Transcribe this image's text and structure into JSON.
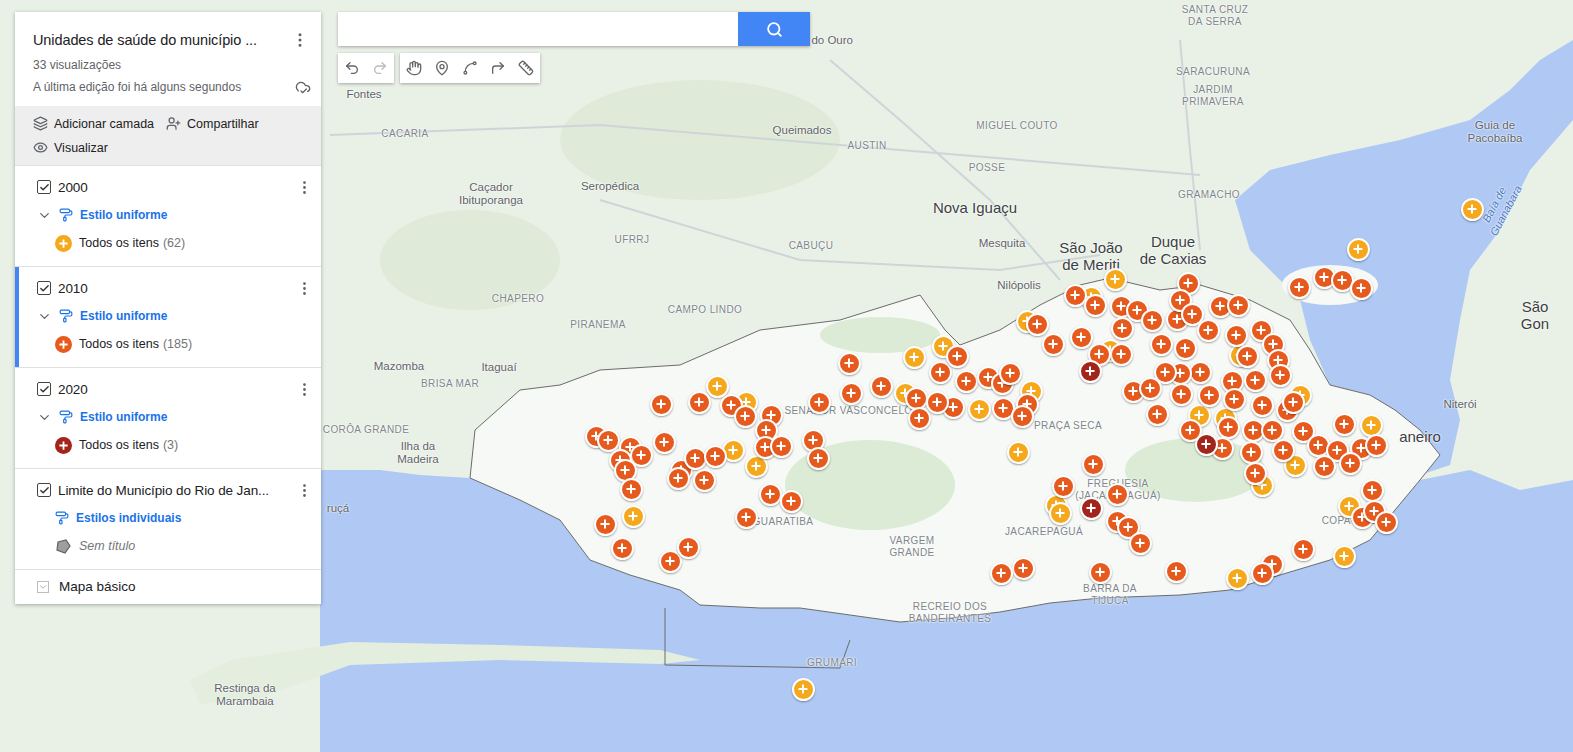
{
  "panel": {
    "title": "Unidades de saúde do município ...",
    "views": "33 visualizações",
    "edited": "A última edição foi há alguns segundos",
    "actions": [
      {
        "label": "Adicionar camada",
        "kind": "layer"
      },
      {
        "label": "Compartilhar",
        "kind": "share"
      },
      {
        "label": "Visualizar",
        "kind": "view"
      }
    ]
  },
  "layers": [
    {
      "name": "2000",
      "checked": true,
      "selected": false,
      "expanded": true,
      "style": "Estilo uniforme",
      "items_label": "Todos os itens",
      "count": "(62)",
      "color": "#f6a81c",
      "kind": "points"
    },
    {
      "name": "2010",
      "checked": true,
      "selected": true,
      "expanded": true,
      "style": "Estilo uniforme",
      "items_label": "Todos os itens",
      "count": "(185)",
      "color": "#e65a1e",
      "kind": "points"
    },
    {
      "name": "2020",
      "checked": true,
      "selected": false,
      "expanded": true,
      "style": "Estilo uniforme",
      "items_label": "Todos os itens",
      "count": "(3)",
      "color": "#a3241a",
      "kind": "points"
    },
    {
      "name": "Limite do Município do Rio de Jan...",
      "checked": true,
      "selected": false,
      "expanded": false,
      "style": "Estilos individuais",
      "items_label": "Sem título",
      "count": "",
      "color": "#5f6368",
      "kind": "boundary"
    }
  ],
  "base_map": {
    "label": "Mapa básico",
    "expanded": false
  },
  "search": {
    "placeholder": ""
  },
  "map": {
    "labels": [
      {
        "text": "Rio do Ouro",
        "kind": "town"
      },
      {
        "text": "SANTA CRUZ\nDA SERRA",
        "kind": "district"
      },
      {
        "text": "SARACURUNA",
        "kind": "district"
      },
      {
        "text": "JARDIM\nPRIMAVERA",
        "kind": "district"
      },
      {
        "text": "Fontes",
        "kind": "town"
      },
      {
        "text": "Queimados",
        "kind": "town"
      },
      {
        "text": "MIGUEL COUTO",
        "kind": "district"
      },
      {
        "text": "AUSTIN",
        "kind": "district"
      },
      {
        "text": "POSSE",
        "kind": "district"
      },
      {
        "text": "CACARIA",
        "kind": "district"
      },
      {
        "text": "GRAMACHO",
        "kind": "district"
      },
      {
        "text": "Guia de\nPacobaíba",
        "kind": "town"
      },
      {
        "text": "Baía de Guanabara",
        "kind": "water"
      },
      {
        "text": "Seropédica",
        "kind": "town"
      },
      {
        "text": "Caçador\nIbituporanga",
        "kind": "town"
      },
      {
        "text": "Nova Iguaçu",
        "kind": "city"
      },
      {
        "text": "São João\nde Meriti",
        "kind": "city"
      },
      {
        "text": "Duque\nde Caxias",
        "kind": "city"
      },
      {
        "text": "UFRRJ",
        "kind": "district"
      },
      {
        "text": "Mesquita",
        "kind": "town"
      },
      {
        "text": "CABUÇU",
        "kind": "district"
      },
      {
        "text": "Nilópolis",
        "kind": "town"
      },
      {
        "text": "CHAPERO",
        "kind": "district"
      },
      {
        "text": "CAMPO LINDO",
        "kind": "district"
      },
      {
        "text": "São Gon",
        "kind": "city"
      },
      {
        "text": "PIRANEMA",
        "kind": "district"
      },
      {
        "text": "Mazomba",
        "kind": "town"
      },
      {
        "text": "Itaguaí",
        "kind": "town"
      },
      {
        "text": "BRISA MAR",
        "kind": "district"
      },
      {
        "text": "Niterói",
        "kind": "town"
      },
      {
        "text": "CORÔA GRANDE",
        "kind": "district"
      },
      {
        "text": "Ilha da\nMadeira",
        "kind": "town"
      },
      {
        "text": "SENADOR VASCONCELOS",
        "kind": "district"
      },
      {
        "text": "PRAÇA SECA",
        "kind": "district"
      },
      {
        "text": "aneiro",
        "kind": "city"
      },
      {
        "text": "GUARATIBA",
        "kind": "district"
      },
      {
        "text": "VARGEM\nGRANDE",
        "kind": "district"
      },
      {
        "text": "JACAREPAGUÁ",
        "kind": "district"
      },
      {
        "text": "COPACABANA",
        "kind": "district"
      },
      {
        "text": "RECREIO DOS\nBANDEIRANTES",
        "kind": "district"
      },
      {
        "text": "Restinga da\nMarambaia",
        "kind": "town"
      },
      {
        "text": "GRUMARI",
        "kind": "district"
      },
      {
        "text": "ruçá",
        "kind": "town"
      },
      {
        "text": "FREGUESIA\n(JACAREPAGUÁ)",
        "kind": "district"
      },
      {
        "text": "BARRA DA\nTIJUCA",
        "kind": "district"
      }
    ]
  }
}
